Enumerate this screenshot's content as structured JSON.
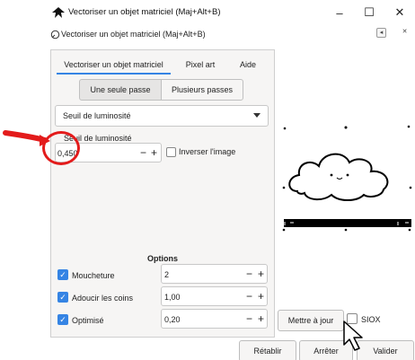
{
  "window": {
    "title": "Vectoriser un objet matriciel (Maj+Alt+B)",
    "minimize_glyph": "–",
    "maximize_glyph": "☐",
    "close_glyph": "✕"
  },
  "dialog": {
    "title": "Vectoriser un objet matriciel (Maj+Alt+B)",
    "restore_glyph": "◂",
    "close_glyph": "✕"
  },
  "tabs": [
    {
      "label": "Vectoriser un objet matriciel",
      "active": true
    },
    {
      "label": "Pixel art",
      "active": false
    },
    {
      "label": "Aide",
      "active": false
    }
  ],
  "pass_toggle": {
    "single": "Une seule passe",
    "multiple": "Plusieurs passes",
    "selected": "single"
  },
  "mode_select": {
    "value": "Seuil de luminosité"
  },
  "threshold": {
    "label": "Seuil de luminosité",
    "value": "0,450",
    "minus": "−",
    "plus": "+"
  },
  "invert": {
    "label": "Inverser l'image",
    "checked": false
  },
  "options": {
    "title": "Options",
    "items": [
      {
        "label": "Moucheture",
        "checked": true,
        "value": "2"
      },
      {
        "label": "Adoucir les coins",
        "checked": true,
        "value": "1,00"
      },
      {
        "label": "Optimisé",
        "checked": true,
        "value": "0,20"
      }
    ],
    "minus": "−",
    "plus": "+"
  },
  "preview_actions": {
    "update_label": "Mettre à jour",
    "siox_label": "SIOX",
    "siox_checked": false
  },
  "footer": {
    "reset_label": "Rétablir",
    "stop_label": "Arrêter",
    "apply_label": "Valider"
  },
  "colors": {
    "accent": "#3584e4",
    "annotation": "#e31b1b"
  }
}
